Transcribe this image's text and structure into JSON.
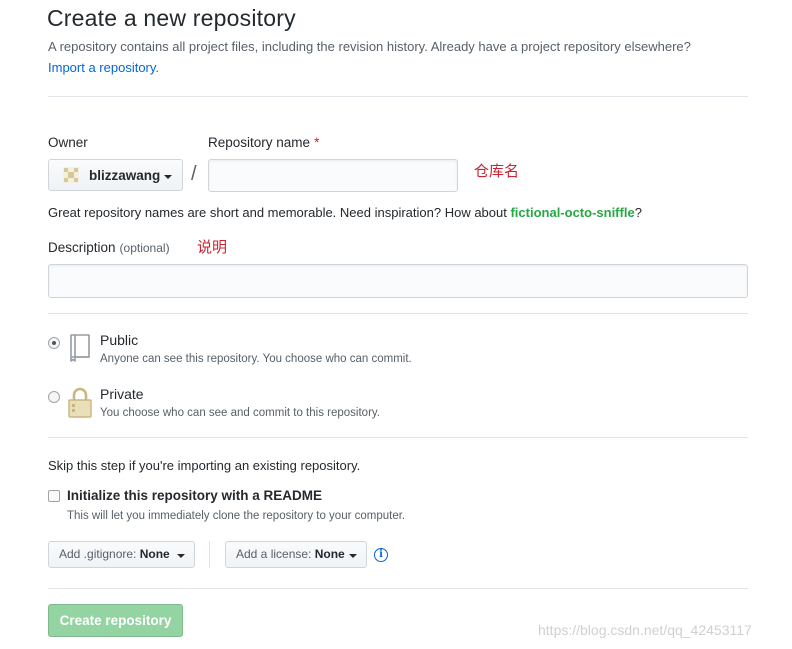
{
  "header": {
    "title": "Create a new repository",
    "subtitle": "A repository contains all project files, including the revision history. Already have a project repository elsewhere?",
    "import_link": "Import a repository",
    "import_period": "."
  },
  "owner": {
    "label": "Owner",
    "name": "blizzawang"
  },
  "repo_name": {
    "label": "Repository name",
    "required_mark": "*",
    "value": "",
    "annotation": "仓库名"
  },
  "name_hint": {
    "text": "Great repository names are short and memorable. Need inspiration? How about ",
    "suggestion": "fictional-octo-sniffle",
    "suffix": "?"
  },
  "description": {
    "label": "Description",
    "optional": "(optional)",
    "value": "",
    "annotation": "说明"
  },
  "visibility": {
    "selected": "public",
    "public": {
      "title": "Public",
      "note": "Anyone can see this repository. You choose who can commit."
    },
    "private": {
      "title": "Private",
      "note": "You choose who can see and commit to this repository."
    }
  },
  "init": {
    "skip_text": "Skip this step if you're importing an existing repository.",
    "readme_label": "Initialize this repository with a README",
    "readme_note": "This will let you immediately clone the repository to your computer.",
    "readme_checked": false
  },
  "gitignore": {
    "prefix": "Add .gitignore:",
    "value": "None"
  },
  "license": {
    "prefix": "Add a license:",
    "value": "None"
  },
  "info_glyph": "i",
  "submit": {
    "label": "Create repository"
  },
  "watermark": "https://blog.csdn.net/qq_42453117",
  "colors": {
    "link": "#0366d6",
    "required": "#cb2431",
    "annotation": "#cb2431",
    "suggestion": "#28a745",
    "create_button_bg": "#94d3a2"
  },
  "icons": {
    "public": "repo-book-icon",
    "private": "lock-icon",
    "owner_avatar": "identicon-avatar",
    "dropdown": "caret-down-icon",
    "info": "info-icon"
  }
}
